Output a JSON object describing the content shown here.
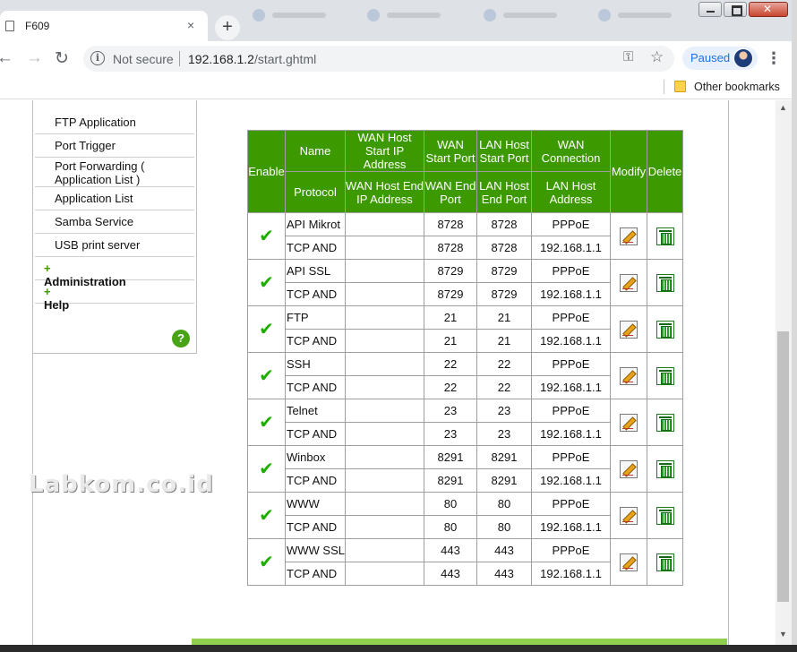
{
  "browser": {
    "tab_title": "F609",
    "tab_close": "×",
    "new_tab": "+",
    "not_secure": "Not secure",
    "url_host": "192.168.1.2",
    "url_path": "/start.ghtml",
    "profile_status": "Paused",
    "other_bookmarks": "Other bookmarks"
  },
  "sidebar": {
    "items": [
      {
        "label": "FTP Application"
      },
      {
        "label": "Port Trigger"
      },
      {
        "label": "Port Forwarding ( Application List )"
      },
      {
        "label": "Application List"
      },
      {
        "label": "Samba Service"
      },
      {
        "label": "USB print server"
      }
    ],
    "groups": [
      {
        "label": "Administration"
      },
      {
        "label": "Help"
      }
    ],
    "help_button": "?"
  },
  "watermark": "Labkom.co.id",
  "table": {
    "headers": {
      "enable": "Enable",
      "name": "Name",
      "protocol": "Protocol",
      "wan_host_start": "WAN Host Start IP Address",
      "wan_host_end": "WAN Host End IP Address",
      "wan_start_port": "WAN Start Port",
      "wan_end_port": "WAN End Port",
      "lan_host_start_port": "LAN Host Start Port",
      "lan_host_end_port": "LAN Host End Port",
      "wan_connection": "WAN Connection",
      "lan_host_address": "LAN Host Address",
      "modify": "Modify",
      "delete": "Delete"
    },
    "rows": [
      {
        "enabled": true,
        "name": "API Mikrot",
        "protocol": "TCP AND",
        "wan_start": "",
        "wan_end": "",
        "wan_start_port": "8728",
        "wan_end_port": "8728",
        "lan_start_port": "8728",
        "lan_end_port": "8728",
        "wan_connection": "PPPoE",
        "lan_host": "192.168.1.1"
      },
      {
        "enabled": true,
        "name": "API SSL",
        "protocol": "TCP AND",
        "wan_start": "",
        "wan_end": "",
        "wan_start_port": "8729",
        "wan_end_port": "8729",
        "lan_start_port": "8729",
        "lan_end_port": "8729",
        "wan_connection": "PPPoE",
        "lan_host": "192.168.1.1"
      },
      {
        "enabled": true,
        "name": "FTP",
        "protocol": "TCP AND",
        "wan_start": "",
        "wan_end": "",
        "wan_start_port": "21",
        "wan_end_port": "21",
        "lan_start_port": "21",
        "lan_end_port": "21",
        "wan_connection": "PPPoE",
        "lan_host": "192.168.1.1"
      },
      {
        "enabled": true,
        "name": "SSH",
        "protocol": "TCP AND",
        "wan_start": "",
        "wan_end": "",
        "wan_start_port": "22",
        "wan_end_port": "22",
        "lan_start_port": "22",
        "lan_end_port": "22",
        "wan_connection": "PPPoE",
        "lan_host": "192.168.1.1"
      },
      {
        "enabled": true,
        "name": "Telnet",
        "protocol": "TCP AND",
        "wan_start": "",
        "wan_end": "",
        "wan_start_port": "23",
        "wan_end_port": "23",
        "lan_start_port": "23",
        "lan_end_port": "23",
        "wan_connection": "PPPoE",
        "lan_host": "192.168.1.1"
      },
      {
        "enabled": true,
        "name": "Winbox",
        "protocol": "TCP AND",
        "wan_start": "",
        "wan_end": "",
        "wan_start_port": "8291",
        "wan_end_port": "8291",
        "lan_start_port": "8291",
        "lan_end_port": "8291",
        "wan_connection": "PPPoE",
        "lan_host": "192.168.1.1"
      },
      {
        "enabled": true,
        "name": "WWW",
        "protocol": "TCP AND",
        "wan_start": "",
        "wan_end": "",
        "wan_start_port": "80",
        "wan_end_port": "80",
        "lan_start_port": "80",
        "lan_end_port": "80",
        "wan_connection": "PPPoE",
        "lan_host": "192.168.1.1"
      },
      {
        "enabled": true,
        "name": "WWW SSL",
        "protocol": "TCP AND",
        "wan_start": "",
        "wan_end": "",
        "wan_start_port": "443",
        "wan_end_port": "443",
        "lan_start_port": "443",
        "lan_end_port": "443",
        "wan_connection": "PPPoE",
        "lan_host": "192.168.1.1"
      }
    ]
  },
  "colors": {
    "header_green": "#3c9a00",
    "check_green": "#1fae00",
    "accent_blue": "#1a73e8"
  }
}
